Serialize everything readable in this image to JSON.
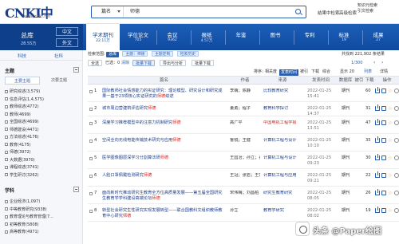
{
  "brand": {
    "logo_text": "CNKI中国知网",
    "url": "www.cnki.net"
  },
  "search": {
    "field": "篇名",
    "query": "师德"
  },
  "topbar": {
    "results_search": "结果中检索",
    "advanced": "高级检索",
    "right_lines": [
      "知识元检索",
      "引文检索"
    ]
  },
  "library": {
    "name": "总库",
    "count": "28.55万",
    "lang_zh": "中文",
    "lang_en": "外文"
  },
  "nav_tabs": [
    {
      "label": "学术期刊",
      "count": "22.11万",
      "active": true
    },
    {
      "label": "学位论文",
      "count": "705",
      "active": false
    },
    {
      "label": "会议",
      "count": "9362",
      "active": false
    },
    {
      "label": "报纸",
      "count": "4.57万",
      "active": false
    },
    {
      "label": "年鉴",
      "count": "",
      "active": false
    },
    {
      "label": "图书",
      "count": "",
      "active": false
    },
    {
      "label": "专利",
      "count": "",
      "active": false
    },
    {
      "label": "标准",
      "count": "19",
      "active": false
    },
    {
      "label": "成果",
      "count": "27",
      "active": false
    }
  ],
  "sidebar": {
    "tabs": [
      "科技",
      "社科"
    ],
    "section_subject": "主题",
    "subtabs": [
      "主要主题",
      "次要主题"
    ],
    "subject_items": [
      "研究综述(3,579)",
      "信息评估(1,4,575)",
      "教师综述(4772)",
      "教师(4699)",
      "全国综述(4699)",
      "师德建设(4471)",
      "方法综述(4176)",
      "教育(4175)",
      "师德(3972)",
      "大数据(3970)",
      "课程综述(3741)",
      "学生研讨(3262)"
    ],
    "section_discipline": "学科",
    "discipline_items": [
      "企业经济(1,097)",
      "中等教育研究(9338)",
      "教育理论与教育管理(7...",
      "初等教育(5808)",
      "高等教育(4971)"
    ]
  },
  "toolbar": {
    "crumbs_prefix": "检索范围:",
    "chips": [
      "总库",
      "主题：师德"
    ],
    "crumbs_tail": "主题定制",
    "history": "检索历史",
    "summary": "共找到 221,902 条结果",
    "pager": "1/300",
    "select_all": "全选",
    "selected": "已选：0",
    "clear": "清除",
    "batch_dl": "批量下载",
    "export": "导出与分析",
    "sort_label": "排序：",
    "sort_options": [
      "相关度",
      "发表时间",
      "被引",
      "下载",
      "综合"
    ],
    "display": "显示 20",
    "list_mode": "列表",
    "detail_mode": "详情"
  },
  "table": {
    "headers": [
      "篇名",
      "作者",
      "来源",
      "发表时间",
      "数据库",
      "被引",
      "下载",
      "操作"
    ],
    "rows": [
      {
        "no": "1",
        "title_pre": "国际教师社会情感能力的实证研究：理论模型、研究设计和研究成果一基于23项核心实证研究的",
        "title_hl": "师德",
        "title_post": "综述",
        "author": "李萌；陈静",
        "source": "比较教育研究",
        "source_red": false,
        "date": "2022-01-25 15:41",
        "db": "期刊",
        "cite": "",
        "dl": "60"
      },
      {
        "no": "2",
        "title_pre": "城市周边营建筑评估研究",
        "title_hl": "师德",
        "title_post": "",
        "author": "董勇；程子",
        "source": "教育科学探讨",
        "source_red": false,
        "date": "2022-01-25 14:37",
        "db": "期刊",
        "cite": "",
        "dl": "31"
      },
      {
        "no": "3",
        "title_pre": "深度学习推荐模型中的注意力机制研究",
        "title_hl": "师德",
        "title_post": "",
        "author": "高广平",
        "source": "中国电机工程学报",
        "source_red": true,
        "date": "2022-01-25 13:51",
        "db": "期刊",
        "cite": "",
        "dl": "47"
      },
      {
        "no": "4",
        "title_pre": "空间全向无线电能传输技术研究与应用",
        "title_hl": "师德",
        "title_post": "",
        "author": "鲁锐；王健",
        "source": "计算机工程与设计",
        "source_red": false,
        "date": "2022-01-25 10:10",
        "db": "期刊",
        "cite": "",
        "dl": "35"
      },
      {
        "no": "5",
        "title_pre": "医学图像图层深学习分割算法研",
        "title_hl": "师德",
        "title_post": "",
        "author": "王国冶；孙立；孙娟",
        "source": "计算机工程与设计",
        "source_red": false,
        "date": "2022-01-25 09:23",
        "db": "期刊",
        "cite": "",
        "dl": "30"
      },
      {
        "no": "6",
        "title_pre": "人脸口罩佩戴检测研究",
        "title_hl": "师德",
        "title_post": "",
        "author": "王冠；张岩；王萧",
        "source": "计算机工程与应用",
        "source_red": false,
        "date": "2022-01-25 09:21",
        "db": "期刊",
        "cite": "",
        "dl": "22"
      },
      {
        "no": "7",
        "title_pre": "面向新时代推动研究生教育全方位高质量发展——第五届全国研究生教育学学科建设高端论坛",
        "title_hl": "师德",
        "title_post": "",
        "author": "宋伟梅；刘昌柏",
        "source": "研究生教育研究",
        "source_red": false,
        "date": "2022-01-25 08:05",
        "db": "期刊",
        "cite": "",
        "dl": "26"
      },
      {
        "no": "8",
        "title_pre": "转型社会研究生性研究实现发展转型——联合国教科文组织教师教育中心研究",
        "title_hl": "师德",
        "title_post": "",
        "author": "孙立",
        "source": "教育学研究",
        "source_red": false,
        "date": "2022-01-25 08:02",
        "db": "期刊",
        "cite": "",
        "dl": "19"
      }
    ]
  },
  "watermark": {
    "text": "头条 @Paper绘图"
  },
  "colors": {
    "brand_blue": "#0f4aa0",
    "highlight_red": "#d91e18",
    "link_blue": "#1a3c8c"
  }
}
